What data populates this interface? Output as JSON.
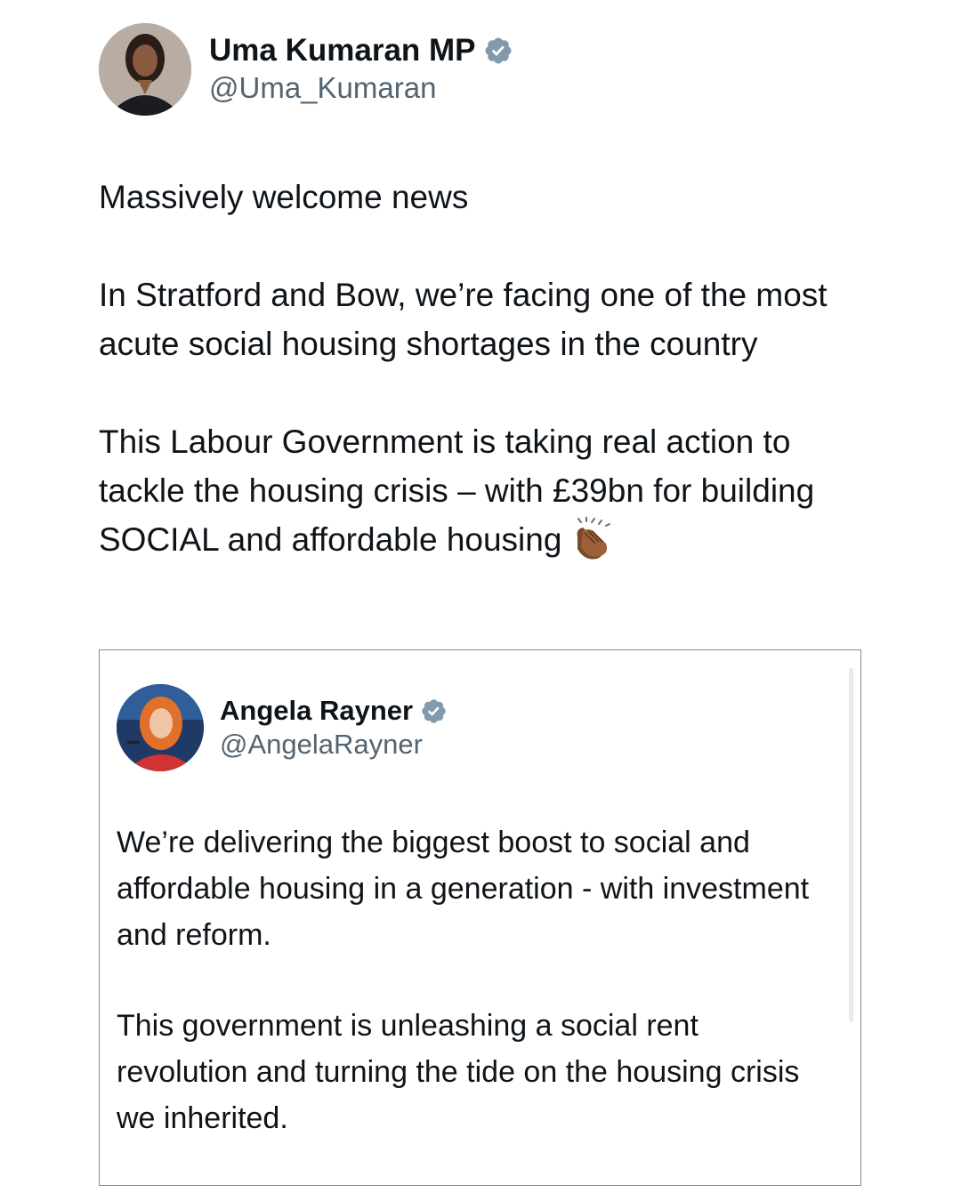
{
  "tweet": {
    "author_name": "Uma Kumaran MP",
    "handle": "@Uma_Kumaran",
    "paragraphs": [
      "Massively welcome news",
      "In Stratford and Bow, we’re facing one of the most acute social housing shortages in the country",
      "This Labour Government is taking real action to tackle the housing crisis – with £39bn for building SOCIAL and affordable housing"
    ],
    "emoji": "clapping-hands-icon"
  },
  "quoted_tweet": {
    "author_name": "Angela Rayner",
    "handle": "@AngelaRayner",
    "paragraphs": [
      "We’re delivering the biggest boost to social and affordable housing in a generation - with investment and reform.",
      "This government is unleashing a social rent revolution and turning the tide on the housing crisis we inherited."
    ]
  },
  "colors": {
    "verified_badge": "#829aab",
    "text_primary": "#0f1419",
    "text_secondary": "#536471"
  }
}
